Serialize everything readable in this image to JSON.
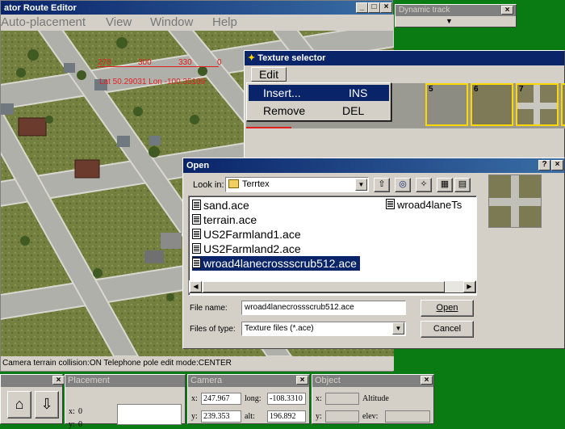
{
  "main_window": {
    "title": "ator Route Editor",
    "menu": [
      "Auto-placement",
      "View",
      "Window",
      "Help"
    ],
    "status": "Camera terrain collision:ON Telephone pole edit mode:CENTER"
  },
  "compass": {
    "ticks": [
      "270",
      "300",
      "330",
      "0"
    ],
    "coords": "Lat 50.29031 Lon -100.35109"
  },
  "dynamic_track": {
    "title": "Dynamic track"
  },
  "texture_selector": {
    "title": "Texture selector",
    "menu_edit": "Edit",
    "dropdown": [
      {
        "label": "Insert...",
        "shortcut": "INS"
      },
      {
        "label": "Remove",
        "shortcut": "DEL"
      }
    ],
    "tiles": [
      "5",
      "6",
      "7"
    ]
  },
  "open_dialog": {
    "title": "Open",
    "look_in_label": "Look in:",
    "look_in_value": "Terrtex",
    "files": [
      "sand.ace",
      "terrain.ace",
      "US2Farmland1.ace",
      "US2Farmland2.ace",
      "wroad4lanecrossscrub512.ace"
    ],
    "files_col2": [
      "wroad4laneTs"
    ],
    "selected_file": "wroad4lanecrossscrub512.ace",
    "file_name_label": "File name:",
    "file_name_value": "wroad4lanecrossscrub512.ace",
    "file_type_label": "Files of type:",
    "file_type_value": "Texture files (*.ace)",
    "open_button": "Open",
    "cancel_button": "Cancel",
    "help_btn": "?",
    "close_btn": "×"
  },
  "placement_panel": {
    "title": "Placement",
    "x_label": "x:",
    "x_value": "0",
    "y_label": "y:",
    "y_value": "0"
  },
  "camera_panel": {
    "title": "Camera",
    "x_label": "x:",
    "x_value": "247.967",
    "y_label": "y:",
    "y_value": "239.353",
    "long_label": "long:",
    "long_value": "-108.3310",
    "alt_label": "alt:",
    "alt_value": "196.892"
  },
  "object_panel": {
    "title": "Object",
    "x_label": "x:",
    "y_label": "y:",
    "altitude_label": "Altitude",
    "elev_label": "elev:"
  },
  "colors": {
    "titlebar_active": "#0a246a",
    "desktop": "#0a7a12",
    "selection": "#0a246a",
    "tile_border": "#ffd800"
  }
}
